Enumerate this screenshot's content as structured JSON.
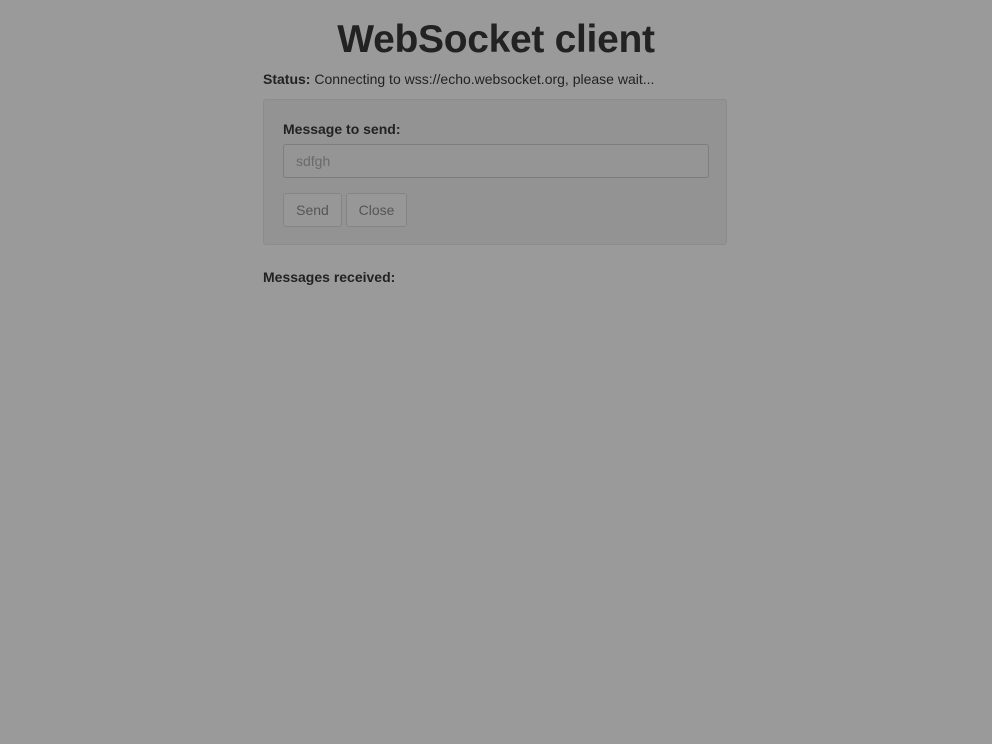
{
  "page": {
    "title": "WebSocket client"
  },
  "status": {
    "label": "Status:",
    "text": "Connecting to wss://echo.websocket.org, please wait..."
  },
  "send_panel": {
    "label": "Message to send:",
    "input_value": "sdfgh",
    "send_label": "Send",
    "close_label": "Close"
  },
  "received": {
    "label": "Messages received:",
    "messages": []
  },
  "colors": {
    "overlay_background": "#9a9a9a",
    "text": "#232323"
  }
}
